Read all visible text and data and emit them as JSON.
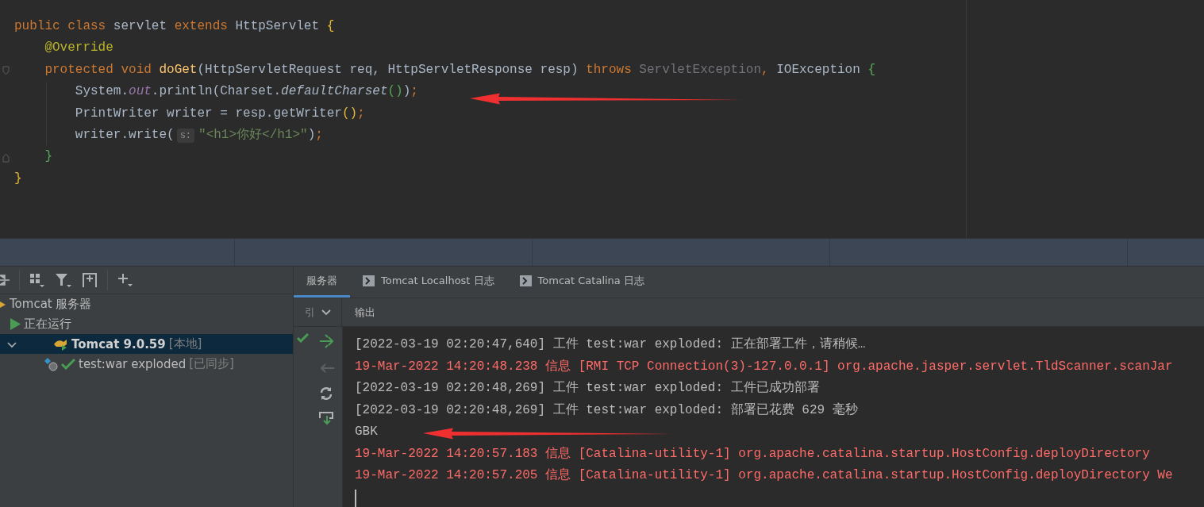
{
  "editor": {
    "lines": [
      [
        {
          "kind": "keyword",
          "text": "public class "
        },
        {
          "kind": "plain",
          "text": "servlet "
        },
        {
          "kind": "keyword",
          "text": "extends "
        },
        {
          "kind": "plain",
          "text": "HttpServlet "
        },
        {
          "kind": "brace",
          "text": "{"
        }
      ],
      [
        {
          "kind": "annotation",
          "text": "    @Override"
        }
      ],
      [
        {
          "kind": "keyword",
          "text": "    protected void "
        },
        {
          "kind": "method",
          "text": "doGet"
        },
        {
          "kind": "plain",
          "text": "(HttpServletRequest req, HttpServletResponse resp) "
        },
        {
          "kind": "keyword",
          "text": "throws "
        },
        {
          "kind": "dim",
          "text": "ServletException"
        },
        {
          "kind": "keyword",
          "text": ", "
        },
        {
          "kind": "plain",
          "text": "IOException "
        },
        {
          "kind": "green",
          "text": "{"
        }
      ],
      [
        {
          "kind": "plain",
          "text": "        System."
        },
        {
          "kind": "field",
          "text": "out"
        },
        {
          "kind": "plain",
          "text": ".println(Charset."
        },
        {
          "kind": "italic",
          "text": "defaultCharset"
        },
        {
          "kind": "green",
          "text": "()"
        },
        {
          "kind": "plain",
          "text": ")"
        },
        {
          "kind": "keyword",
          "text": ";"
        }
      ],
      [
        {
          "kind": "plain",
          "text": "        PrintWriter writer = resp.getWriter"
        },
        {
          "kind": "brace",
          "text": "()"
        },
        {
          "kind": "keyword",
          "text": ";"
        }
      ],
      [
        {
          "kind": "plain",
          "text": "        writer.write("
        },
        {
          "kind": "hint",
          "text": "s:"
        },
        {
          "kind": "string",
          "text": "\"<h1>你好</h1>\""
        },
        {
          "kind": "plain",
          "text": ")"
        },
        {
          "kind": "keyword",
          "text": ";"
        }
      ],
      [
        {
          "kind": "green",
          "text": "    }"
        }
      ],
      [
        {
          "kind": "brace",
          "text": "}"
        }
      ]
    ]
  },
  "services": {
    "tree": [
      {
        "label": "Tomcat 服务器",
        "kind": "server-group",
        "children": [
          {
            "label": "正在运行",
            "kind": "run-state",
            "children": [
              {
                "label": "Tomcat 9.0.59",
                "tag": "[本地]",
                "kind": "server",
                "selected": true,
                "expanded": true,
                "children": [
                  {
                    "label": "test:war exploded",
                    "tag": "[已同步]",
                    "kind": "artifact",
                    "selected": false
                  }
                ]
              }
            ]
          }
        ]
      }
    ]
  },
  "tabs": [
    {
      "label": "服务器",
      "kind": "plain",
      "selected": true
    },
    {
      "label": "Tomcat Localhost 日志",
      "kind": "console",
      "selected": false
    },
    {
      "label": "Tomcat Catalina 日志",
      "kind": "console",
      "selected": false
    }
  ],
  "console": {
    "selector": "引",
    "header": "输出",
    "lines": [
      {
        "kind": "info",
        "text": "[2022-03-19 02:20:47,640] 工件 test:war exploded: 正在部署工件，请稍候…"
      },
      {
        "kind": "error",
        "text": "19-Mar-2022 14:20:48.238 信息 [RMI TCP Connection(3)-127.0.0.1] org.apache.jasper.servlet.TldScanner.scanJar"
      },
      {
        "kind": "info",
        "text": "[2022-03-19 02:20:48,269] 工件 test:war exploded: 工件已成功部署"
      },
      {
        "kind": "info",
        "text": "[2022-03-19 02:20:48,269] 工件 test:war exploded: 部署已花费 629 毫秒"
      },
      {
        "kind": "info",
        "text": "GBK"
      },
      {
        "kind": "error",
        "text": "19-Mar-2022 14:20:57.183 信息 [Catalina-utility-1] org.apache.catalina.startup.HostConfig.deployDirectory"
      },
      {
        "kind": "error",
        "text": "19-Mar-2022 14:20:57.205 信息 [Catalina-utility-1] org.apache.catalina.startup.HostConfig.deployDirectory We"
      }
    ]
  }
}
